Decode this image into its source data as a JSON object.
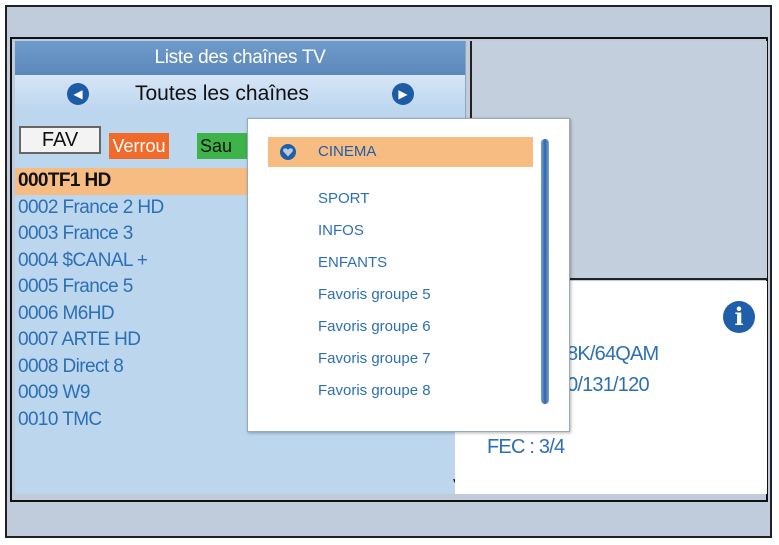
{
  "channel_list": {
    "title": "Liste des chaînes TV",
    "category": "Toutes les chaînes",
    "buttons": {
      "fav": "FAV",
      "verrou": "Verrou",
      "sauter": "Sau"
    },
    "channels": [
      "000TF1 HD",
      "0002 France 2 HD",
      "0003 France 3",
      "0004 $CANAL +",
      "0005 France 5",
      "0006 M6HD",
      "0007 ARTE HD",
      "0008 Direct 8",
      "0009 W9",
      "0010 TMC"
    ],
    "selected_index": 0
  },
  "info": {
    "line1": "8K/64QAM",
    "line2": "0/131/120",
    "fec": "FEC : 3/4"
  },
  "favorites_popup": {
    "items": [
      "CINEMA",
      "SPORT",
      "INFOS",
      "ENFANTS",
      "Favoris groupe 5",
      "Favoris groupe 6",
      "Favoris groupe 7",
      "Favoris groupe 8"
    ],
    "selected_index": 0
  },
  "colors": {
    "header_blue": "#5c87ba",
    "list_bg": "#bcd6ee",
    "selection": "#f6bc82",
    "text_blue": "#2c6fb5",
    "verrou": "#f06a2a",
    "sauter": "#3cb44a"
  }
}
